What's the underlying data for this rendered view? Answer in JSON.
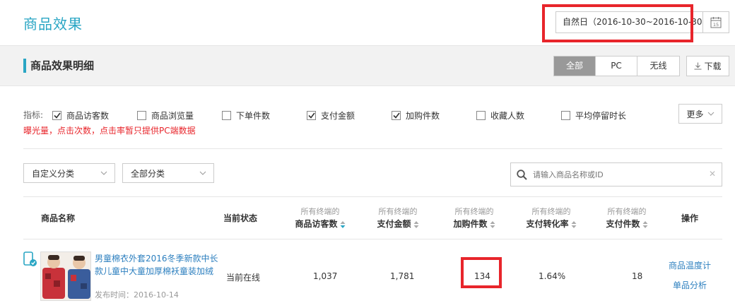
{
  "header": {
    "title": "商品效果",
    "date_range": "自然日（2016-10-30~2016-10-30）",
    "calendar_day": "15"
  },
  "section": {
    "title": "商品效果明细",
    "segments": [
      {
        "label": "全部",
        "active": true
      },
      {
        "label": "PC",
        "active": false
      },
      {
        "label": "无线",
        "active": false
      }
    ],
    "download_label": "下载"
  },
  "indicators": {
    "label": "指标:",
    "items": [
      {
        "label": "商品访客数",
        "checked": true
      },
      {
        "label": "商品浏览量",
        "checked": false
      },
      {
        "label": "下单件数",
        "checked": false
      },
      {
        "label": "支付金额",
        "checked": true
      },
      {
        "label": "加购件数",
        "checked": true
      },
      {
        "label": "收藏人数",
        "checked": false
      },
      {
        "label": "平均停留时长",
        "checked": false
      }
    ],
    "note": "曝光量，点击次数，点击率暂只提供PC端数据",
    "more_label": "更多"
  },
  "filters": {
    "category1": "自定义分类",
    "category2": "全部分类",
    "search_placeholder": "请输入商品名称或ID"
  },
  "table": {
    "headers": {
      "name": "商品名称",
      "status": "当前状态",
      "prefix": "所有终端的",
      "visitors": "商品访客数",
      "payment": "支付金额",
      "cart": "加购件数",
      "conversion": "支付转化率",
      "pieces": "支付件数",
      "ops": "操作"
    },
    "row": {
      "title": "男童棉衣外套2016冬季新款中长款儿童中大童加厚棉袄童装加绒",
      "publish": "发布时间：2016-10-14",
      "status": "当前在线",
      "visitors": "1,037",
      "payment": "1,781",
      "cart": "134",
      "conversion": "1.64%",
      "pieces": "18",
      "op1": "商品温度计",
      "op2": "单品分析"
    }
  },
  "colors": {
    "accent": "#2aa6c4",
    "link": "#2c7fbf",
    "highlight": "#e8252b"
  }
}
